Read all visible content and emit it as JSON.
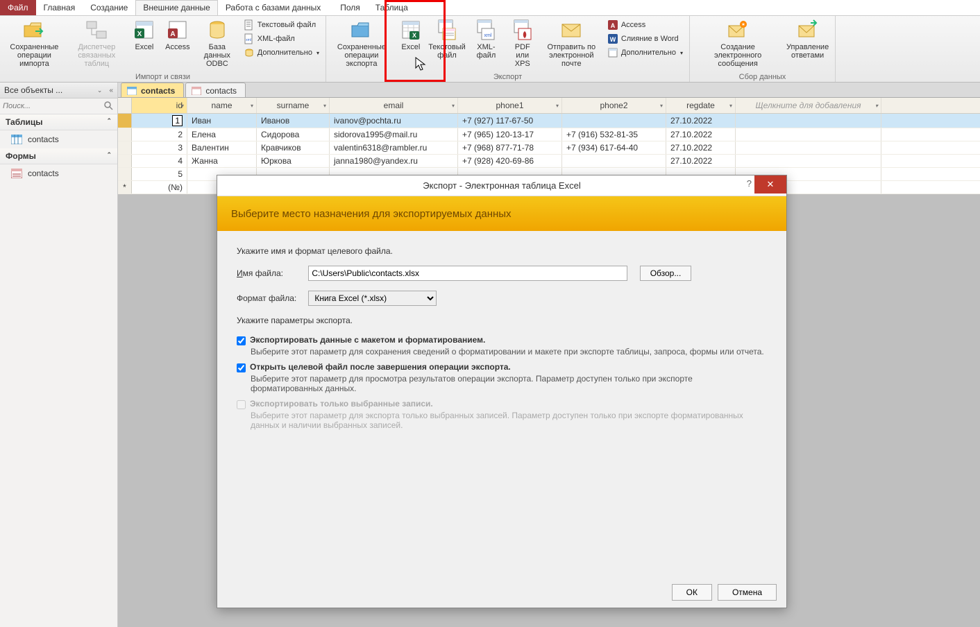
{
  "tabs": {
    "file": "Файл",
    "home": "Главная",
    "create": "Создание",
    "external": "Внешние данные",
    "dbtools": "Работа с базами данных",
    "fields": "Поля",
    "table": "Таблица"
  },
  "ribbon": {
    "import_group_label": "Импорт и связи",
    "export_group_label": "Экспорт",
    "collect_group_label": "Сбор данных",
    "saved_imports": "Сохраненные\nоперации импорта",
    "linked_mgr": "Диспетчер\nсвязанных таблиц",
    "excel": "Excel",
    "access": "Access",
    "odbc": "База данных\nODBC",
    "text_file": "Текстовый файл",
    "xml_file": "XML-файл",
    "more1": "Дополнительно",
    "saved_exports": "Сохраненные\nоперации экспорта",
    "exp_excel": "Excel",
    "exp_text": "Текстовый\nфайл",
    "exp_xml": "XML-файл",
    "exp_pdf": "PDF\nили XPS",
    "exp_mail": "Отправить по\nэлектронной почте",
    "exp_access": "Access",
    "exp_word": "Слияние в Word",
    "more2": "Дополнительно",
    "create_mail": "Создание электронного\nсообщения",
    "manage_replies": "Управление\nответами"
  },
  "nav": {
    "header": "Все объекты ...",
    "search_placeholder": "Поиск...",
    "tables": "Таблицы",
    "forms": "Формы",
    "contacts": "contacts"
  },
  "doc_tabs": {
    "active": "contacts",
    "inactive": "contacts"
  },
  "columns": {
    "id": "id",
    "name": "name",
    "surname": "surname",
    "email": "email",
    "phone1": "phone1",
    "phone2": "phone2",
    "regdate": "regdate",
    "add": "Щелкните для добавления"
  },
  "rows": [
    {
      "id": "1",
      "name": "Иван",
      "surname": "Иванов",
      "email": "ivanov@pochta.ru",
      "phone1": "+7 (927) 117-67-50",
      "phone2": "",
      "regdate": "27.10.2022"
    },
    {
      "id": "2",
      "name": "Елена",
      "surname": "Сидорова",
      "email": "sidorova1995@mail.ru",
      "phone1": "+7 (965) 120-13-17",
      "phone2": "+7 (916) 532-81-35",
      "regdate": "27.10.2022"
    },
    {
      "id": "3",
      "name": "Валентин",
      "surname": "Кравчиков",
      "email": "valentin6318@rambler.ru",
      "phone1": "+7 (968) 877-71-78",
      "phone2": "+7 (934) 617-64-40",
      "regdate": "27.10.2022"
    },
    {
      "id": "4",
      "name": "Жанна",
      "surname": "Юркова",
      "email": "janna1980@yandex.ru",
      "phone1": "+7 (928) 420-69-86",
      "phone2": "",
      "regdate": "27.10.2022"
    },
    {
      "id": "5",
      "name": "",
      "surname": "",
      "email": "",
      "phone1": "",
      "phone2": "",
      "regdate": ""
    }
  ],
  "newrow_label": "(№)",
  "dialog": {
    "title": "Экспорт - Электронная таблица Excel",
    "banner": "Выберите место назначения для экспортируемых данных",
    "instr1": "Укажите имя и формат целевого файла.",
    "lbl_filename": "Имя файла:",
    "filename_value": "C:\\Users\\Public\\contacts.xlsx",
    "browse": "Обзор...",
    "lbl_format": "Формат файла:",
    "format_value": "Книга Excel (*.xlsx)",
    "instr2": "Укажите параметры экспорта.",
    "chk1": "Экспортировать данные с макетом и форматированием.",
    "chk1_desc": "Выберите этот параметр для сохранения сведений о форматировании и макете при экспорте таблицы, запроса, формы или отчета.",
    "chk2": "Открыть целевой файл после завершения операции экспорта.",
    "chk2_desc": "Выберите этот параметр для просмотра результатов операции экспорта. Параметр доступен только при экспорте форматированных данных.",
    "chk3": "Экспортировать только выбранные записи.",
    "chk3_desc": "Выберите этот параметр для экспорта только выбранных записей. Параметр доступен только при экспорте форматированных данных и наличии выбранных записей.",
    "ok": "ОК",
    "cancel": "Отмена"
  }
}
